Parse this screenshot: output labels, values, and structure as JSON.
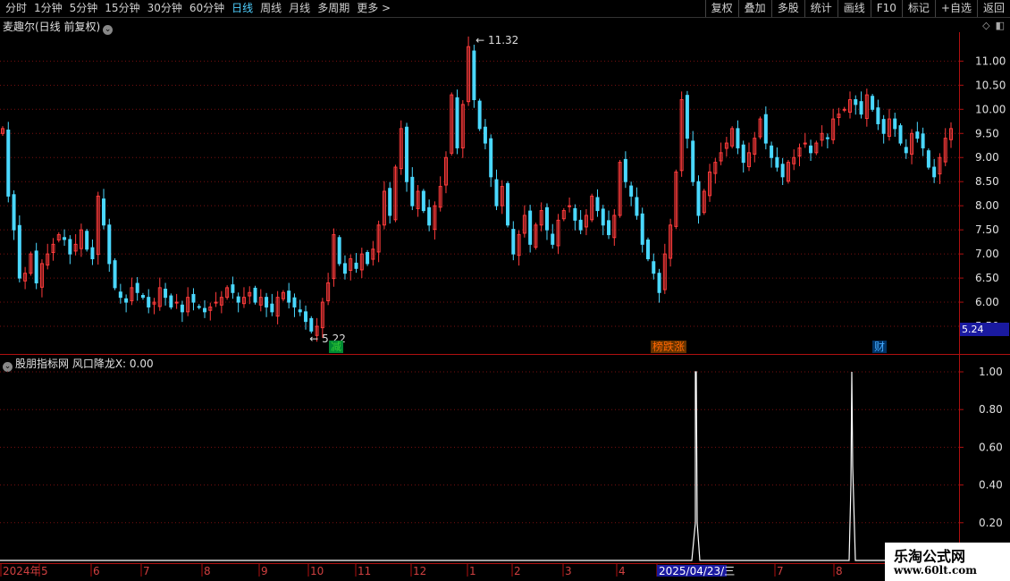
{
  "toolbar": {
    "left": [
      "分时",
      "1分钟",
      "5分钟",
      "15分钟",
      "30分钟",
      "60分钟",
      "日线",
      "周线",
      "月线",
      "多周期",
      "更多 >"
    ],
    "active": "日线",
    "right": [
      "复权",
      "叠加",
      "多股",
      "统计",
      "画线",
      "F10",
      "标记",
      "+自选",
      "返回"
    ]
  },
  "main_panel": {
    "title": "麦趣尔(日线 前复权)",
    "price_label": "5.24",
    "high_label": "11.32",
    "low_label": "5.22",
    "markers": [
      {
        "text": "减",
        "color": "#3c3",
        "bg": "#083"
      },
      {
        "text": "榜跌涨",
        "color": "#f60",
        "bg": "#630"
      },
      {
        "text": "财",
        "color": "#4af",
        "bg": "#036"
      }
    ],
    "y_ticks": [
      "11.00",
      "10.50",
      "10.00",
      "9.50",
      "9.00",
      "8.50",
      "8.00",
      "7.50",
      "7.00",
      "6.50",
      "6.00",
      "5.50"
    ]
  },
  "indicator_panel": {
    "title": "股朋指标网 风口降龙X: 0.00",
    "y_ticks": [
      "1.00",
      "0.80",
      "0.60",
      "0.40",
      "0.20"
    ]
  },
  "date_axis": {
    "labels": [
      "2024年",
      "5",
      "6",
      "7",
      "8",
      "9",
      "10",
      "11",
      "12",
      "1",
      "2",
      "3",
      "4",
      "2025/04/23/三",
      "7",
      "8"
    ]
  },
  "watermark": {
    "line1": "乐淘公式网",
    "line2": "www.60lt.com"
  },
  "chart_data": {
    "type": "candlestick",
    "ylim": [
      5.2,
      11.5
    ],
    "close_series_approx": [
      9.6,
      8.2,
      7.5,
      6.5,
      6.6,
      7.0,
      6.4,
      6.8,
      7.0,
      7.2,
      7.4,
      7.3,
      7.0,
      7.2,
      7.5,
      7.1,
      6.9,
      8.2,
      7.6,
      6.8,
      6.3,
      6.1,
      6.0,
      6.3,
      6.2,
      6.1,
      5.9,
      6.0,
      6.3,
      6.1,
      5.9,
      6.0,
      5.8,
      6.1,
      6.0,
      5.9,
      5.8,
      5.9,
      6.0,
      6.1,
      6.3,
      6.2,
      6.0,
      6.1,
      6.2,
      6.0,
      6.1,
      5.9,
      5.8,
      6.1,
      6.2,
      6.0,
      5.9,
      5.8,
      5.6,
      5.4,
      5.5,
      6.0,
      6.4,
      7.4,
      6.8,
      6.6,
      6.9,
      6.7,
      7.0,
      6.8,
      7.1,
      7.6,
      8.3,
      7.8,
      8.8,
      9.6,
      8.5,
      8.0,
      8.3,
      7.9,
      7.6,
      8.0,
      8.4,
      9.0,
      10.3,
      9.2,
      10.1,
      11.3,
      10.2,
      9.6,
      9.3,
      8.6,
      8.0,
      8.4,
      7.6,
      7.0,
      7.4,
      7.8,
      7.2,
      7.6,
      7.9,
      7.5,
      7.2,
      7.7,
      7.9,
      8.0,
      7.7,
      7.5,
      7.8,
      8.2,
      7.9,
      7.6,
      7.4,
      7.8,
      8.9,
      8.5,
      8.2,
      7.8,
      7.2,
      6.9,
      6.6,
      6.2,
      7.0,
      7.6,
      8.7,
      10.2,
      9.4,
      8.5,
      7.8,
      8.3,
      8.7,
      8.9,
      9.1,
      9.3,
      9.6,
      9.2,
      8.9,
      9.1,
      9.4,
      9.8,
      9.3,
      9.0,
      8.8,
      8.6,
      8.9,
      9.0,
      9.2,
      9.3,
      9.1,
      9.3,
      9.5,
      9.4,
      9.8,
      9.9,
      10.0,
      10.2,
      10.1,
      9.9,
      10.3,
      10.0,
      9.7,
      9.5,
      9.8,
      9.6,
      9.3,
      9.1,
      9.5,
      9.4,
      9.2,
      8.8,
      8.6,
      9.0,
      9.4,
      9.6
    ]
  },
  "colors": {
    "up": "#ff3b3b",
    "down": "#4ad8ff",
    "grid": "#7a1010",
    "axis": "#b01010",
    "signal": "#ffffff"
  }
}
